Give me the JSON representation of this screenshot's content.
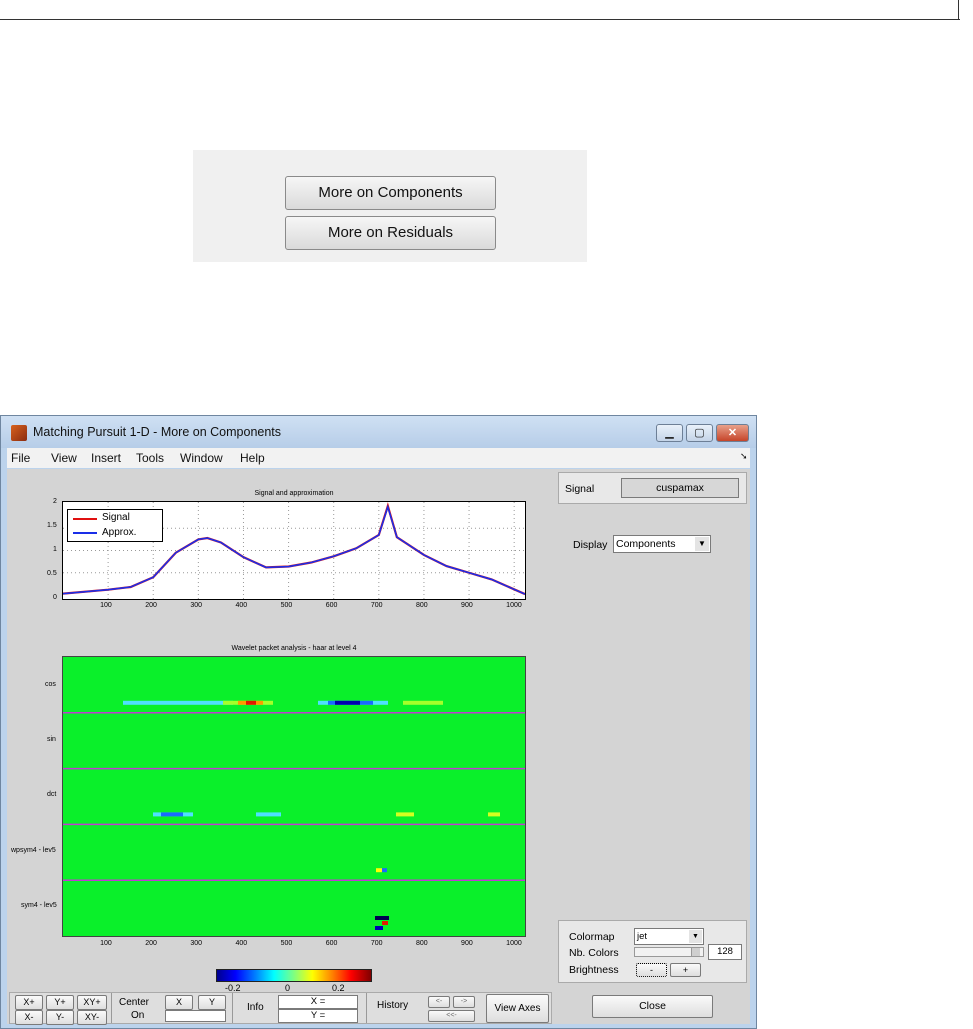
{
  "callout": {
    "components_button": "More on Components",
    "residuals_button": "More on Residuals"
  },
  "window": {
    "title": "Matching Pursuit 1-D - More on Components",
    "controls": [
      "minimize-icon",
      "maximize-icon",
      "close-icon"
    ],
    "menu": [
      "File",
      "View",
      "Insert",
      "Tools",
      "Window",
      "Help"
    ]
  },
  "plot1": {
    "title": "Signal and approximation",
    "legend": [
      {
        "label": "Signal",
        "color": "#e01010"
      },
      {
        "label": "Approx.",
        "color": "#1a2ee8"
      }
    ],
    "yticks": [
      "2",
      "1.5",
      "1",
      "0.5",
      "0"
    ],
    "xticks": [
      "100",
      "200",
      "300",
      "400",
      "500",
      "600",
      "700",
      "800",
      "900",
      "1000"
    ]
  },
  "chart_data": {
    "type": "line",
    "x": [
      0,
      100,
      150,
      200,
      250,
      300,
      320,
      350,
      400,
      450,
      500,
      550,
      600,
      650,
      700,
      720,
      740,
      800,
      850,
      900,
      950,
      1024
    ],
    "series": [
      {
        "name": "Signal",
        "values": [
          0.03,
          0.12,
          0.18,
          0.4,
          0.95,
          1.25,
          1.28,
          1.18,
          0.85,
          0.62,
          0.64,
          0.73,
          0.87,
          1.05,
          1.35,
          2.0,
          1.3,
          0.9,
          0.65,
          0.5,
          0.35,
          0.02
        ]
      },
      {
        "name": "Approx.",
        "values": [
          0.03,
          0.12,
          0.18,
          0.4,
          0.95,
          1.25,
          1.28,
          1.18,
          0.85,
          0.62,
          0.64,
          0.73,
          0.87,
          1.05,
          1.35,
          1.98,
          1.3,
          0.9,
          0.65,
          0.5,
          0.35,
          0.02
        ]
      }
    ],
    "title": "Signal and approximation",
    "ylim": [
      0,
      2
    ],
    "xlim": [
      0,
      1024
    ],
    "grid": true,
    "legend_position": "top-left"
  },
  "plot2": {
    "title": "Wavelet packet analysis - haar at level 4",
    "row_labels": [
      "cos",
      "sin",
      "dct",
      "wpsym4 - lev5",
      "sym4 - lev5"
    ],
    "xticks": [
      "100",
      "200",
      "300",
      "400",
      "500",
      "600",
      "700",
      "800",
      "900",
      "1000"
    ],
    "colorbar_ticks": [
      "-0.2",
      "0",
      "0.2"
    ]
  },
  "bottom": {
    "zoom_buttons": [
      "X+",
      "Y+",
      "XY+",
      "X-",
      "Y-",
      "XY-"
    ],
    "center_label": "Center",
    "on_label": "On",
    "x_btn": "X",
    "y_btn": "Y",
    "info_label": "Info",
    "x_field": "X =",
    "y_field": "Y =",
    "history_label": "History",
    "hist_back": "<-",
    "hist_fwd": "->",
    "hist_first": "<<-",
    "view_axes": "View Axes"
  },
  "right": {
    "signal_label": "Signal",
    "signal_value": "cuspamax",
    "display_label": "Display",
    "display_value": "Components",
    "colormap_label": "Colormap",
    "colormap_value": "jet",
    "nbcolors_label": "Nb. Colors",
    "nbcolors_value": "128",
    "brightness_label": "Brightness",
    "minus": "-",
    "plus": "+",
    "close": "Close"
  }
}
